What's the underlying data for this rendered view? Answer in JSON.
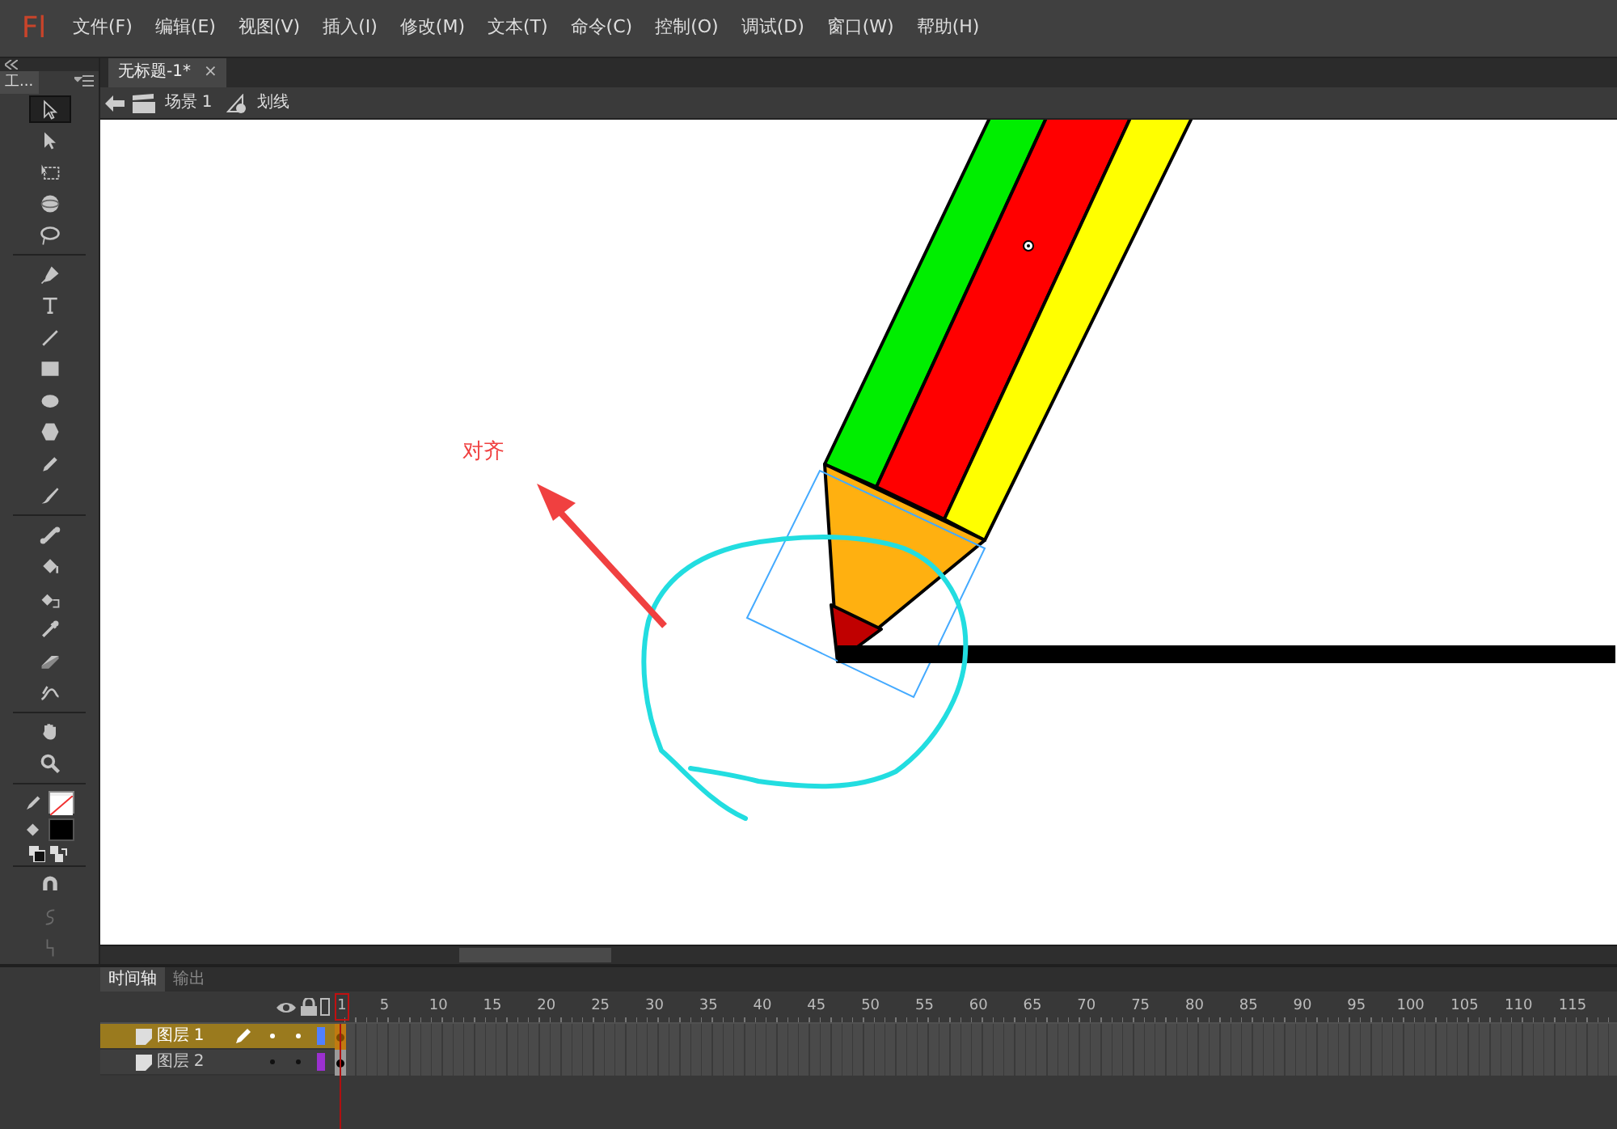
{
  "app": {
    "logo": "Fl"
  },
  "menu": [
    "文件(F)",
    "编辑(E)",
    "视图(V)",
    "插入(I)",
    "修改(M)",
    "文本(T)",
    "命令(C)",
    "控制(O)",
    "调试(D)",
    "窗口(W)",
    "帮助(H)"
  ],
  "tools_panel": {
    "title": "工...",
    "tool_groups": [
      [
        {
          "kind": "selection",
          "selected": true
        },
        {
          "kind": "subselection",
          "selected": false
        },
        {
          "kind": "free-transform",
          "selected": false
        },
        {
          "kind": "rotate-3d",
          "selected": false
        },
        {
          "kind": "lasso",
          "selected": false
        }
      ],
      [
        {
          "kind": "pen",
          "selected": false
        },
        {
          "kind": "text",
          "selected": false
        },
        {
          "kind": "line",
          "selected": false
        },
        {
          "kind": "rectangle",
          "selected": false
        },
        {
          "kind": "oval",
          "selected": false
        },
        {
          "kind": "polystar",
          "selected": false
        },
        {
          "kind": "pencil",
          "selected": false
        },
        {
          "kind": "brush",
          "selected": false
        }
      ],
      [
        {
          "kind": "bone",
          "selected": false
        },
        {
          "kind": "paint-bucket",
          "selected": false
        },
        {
          "kind": "ink-bottle",
          "selected": false
        },
        {
          "kind": "eyedropper",
          "selected": false
        },
        {
          "kind": "eraser",
          "selected": false
        },
        {
          "kind": "width",
          "selected": false
        }
      ],
      [
        {
          "kind": "hand",
          "selected": false
        },
        {
          "kind": "zoom",
          "selected": false
        }
      ]
    ],
    "options": [
      {
        "kind": "snap",
        "disabled": false
      },
      {
        "kind": "smooth",
        "disabled": true
      },
      {
        "kind": "straighten",
        "disabled": true
      }
    ]
  },
  "document_tab": {
    "title": "无标题-1*",
    "close": "×"
  },
  "breadcrumb": [
    "场景 1",
    "划线"
  ],
  "stage": {
    "annotation": "对齐"
  },
  "timeline": {
    "tabs": [
      {
        "label": "时间轴",
        "selected": true
      },
      {
        "label": "输出",
        "selected": false
      }
    ],
    "frame_labels": [
      "1",
      "5",
      "10",
      "15",
      "20",
      "25",
      "30",
      "35",
      "40",
      "45",
      "50",
      "55",
      "60",
      "65",
      "70",
      "75",
      "80",
      "85",
      "90",
      "95",
      "100",
      "105",
      "110",
      "115"
    ],
    "layers": [
      {
        "name": "图层 1",
        "selected": true,
        "color": "#5080ff"
      },
      {
        "name": "图层 2",
        "selected": false,
        "color": "#9b30d0"
      }
    ]
  }
}
